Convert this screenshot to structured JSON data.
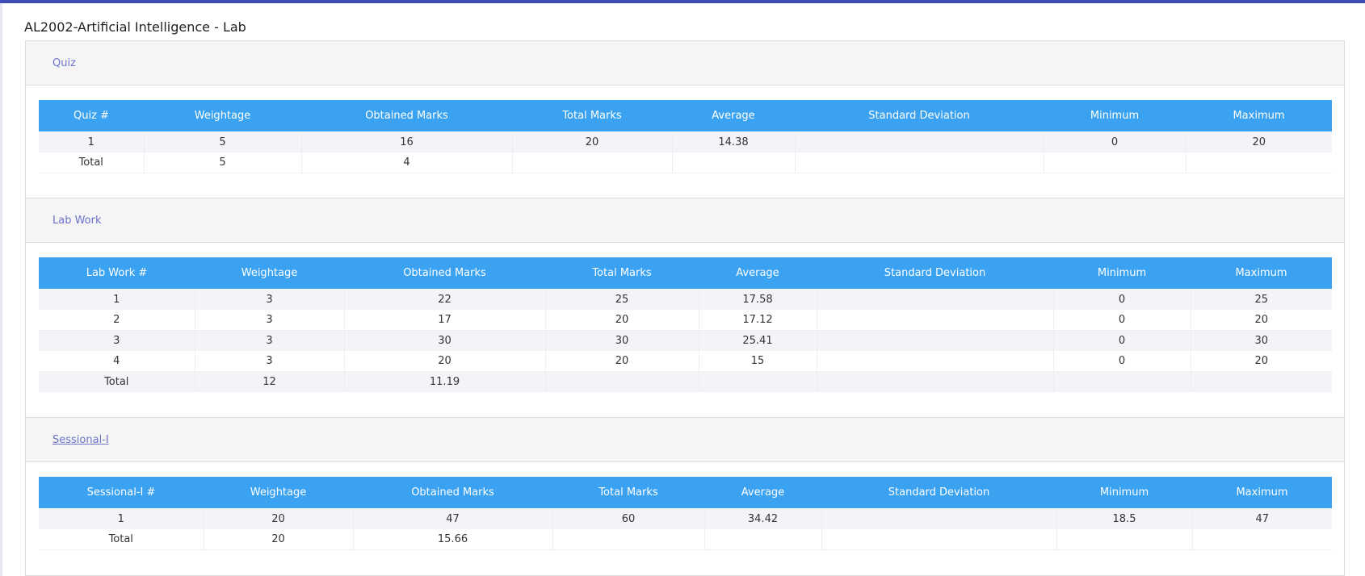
{
  "course": {
    "title": "AL2002-Artificial Intelligence - Lab"
  },
  "quiz": {
    "header": "Quiz",
    "columns": [
      "Quiz #",
      "Weightage",
      "Obtained Marks",
      "Total Marks",
      "Average",
      "Standard Deviation",
      "Minimum",
      "Maximum"
    ],
    "rows": [
      [
        "1",
        "5",
        "16",
        "20",
        "14.38",
        "",
        "0",
        "20"
      ],
      [
        "Total",
        "5",
        "4",
        "",
        "",
        "",
        "",
        ""
      ]
    ]
  },
  "lab_work": {
    "header": "Lab Work",
    "columns": [
      "Lab Work #",
      "Weightage",
      "Obtained Marks",
      "Total Marks",
      "Average",
      "Standard Deviation",
      "Minimum",
      "Maximum"
    ],
    "rows": [
      [
        "1",
        "3",
        "22",
        "25",
        "17.58",
        "",
        "0",
        "25"
      ],
      [
        "2",
        "3",
        "17",
        "20",
        "17.12",
        "",
        "0",
        "20"
      ],
      [
        "3",
        "3",
        "30",
        "30",
        "25.41",
        "",
        "0",
        "30"
      ],
      [
        "4",
        "3",
        "20",
        "20",
        "15",
        "",
        "0",
        "20"
      ],
      [
        "Total",
        "12",
        "11.19",
        "",
        "",
        "",
        "",
        ""
      ]
    ]
  },
  "sessional_1": {
    "header": "Sessional-I",
    "columns": [
      "Sessional-I #",
      "Weightage",
      "Obtained Marks",
      "Total Marks",
      "Average",
      "Standard Deviation",
      "Minimum",
      "Maximum"
    ],
    "rows": [
      [
        "1",
        "20",
        "47",
        "60",
        "34.42",
        "",
        "18.5",
        "47"
      ],
      [
        "Total",
        "20",
        "15.66",
        "",
        "",
        "",
        "",
        ""
      ]
    ]
  }
}
